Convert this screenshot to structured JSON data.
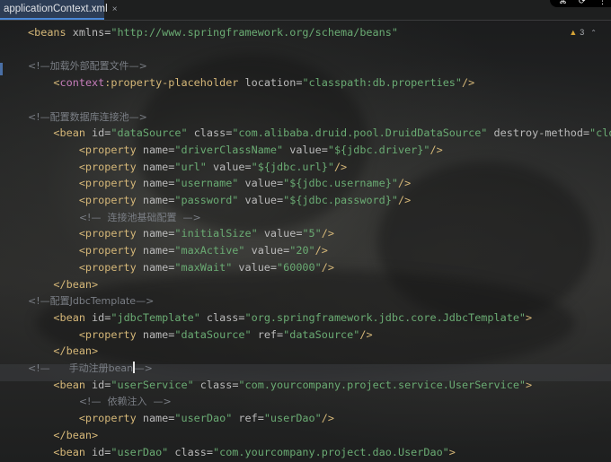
{
  "tab": {
    "filename": "applicationContext.xml",
    "close": "×"
  },
  "window_controls": {
    "icons": [
      "⌘",
      "⟳",
      "⋮"
    ]
  },
  "inspection": {
    "warnings": "3"
  },
  "lines": [
    [
      [
        "t",
        "<"
      ],
      [
        "t",
        "beans"
      ],
      [
        "a",
        " xmlns="
      ],
      [
        "v",
        "\"http://www.springframework.org/schema/beans\""
      ]
    ],
    [],
    [
      [
        "c",
        "<!—加载外部配置文件—>"
      ]
    ],
    [
      [
        "p",
        "    "
      ],
      [
        "t",
        "<"
      ],
      [
        "ns",
        "context"
      ],
      [
        "t",
        ":property-placeholder"
      ],
      [
        "a",
        " location="
      ],
      [
        "v",
        "\"classpath:db.properties\""
      ],
      [
        "t",
        "/>"
      ]
    ],
    [],
    [
      [
        "c",
        "<!—配置数据库连接池—>"
      ]
    ],
    [
      [
        "p",
        "    "
      ],
      [
        "t",
        "<bean"
      ],
      [
        "a",
        " id="
      ],
      [
        "v",
        "\"dataSource\""
      ],
      [
        "a",
        " class="
      ],
      [
        "v",
        "\"com.alibaba.druid.pool.DruidDataSource\""
      ],
      [
        "a",
        " destroy-method="
      ],
      [
        "v",
        "\"close\""
      ],
      [
        "t",
        ">"
      ]
    ],
    [
      [
        "p",
        "        "
      ],
      [
        "t",
        "<property"
      ],
      [
        "a",
        " name="
      ],
      [
        "v",
        "\"driverClassName\""
      ],
      [
        "a",
        " value="
      ],
      [
        "v",
        "\"${jdbc.driver}\""
      ],
      [
        "t",
        "/>"
      ]
    ],
    [
      [
        "p",
        "        "
      ],
      [
        "t",
        "<property"
      ],
      [
        "a",
        " name="
      ],
      [
        "v",
        "\"url\""
      ],
      [
        "a",
        " value="
      ],
      [
        "v",
        "\"${jdbc.url}\""
      ],
      [
        "t",
        "/>"
      ]
    ],
    [
      [
        "p",
        "        "
      ],
      [
        "t",
        "<property"
      ],
      [
        "a",
        " name="
      ],
      [
        "v",
        "\"username\""
      ],
      [
        "a",
        " value="
      ],
      [
        "v",
        "\"${jdbc.username}\""
      ],
      [
        "t",
        "/>"
      ]
    ],
    [
      [
        "p",
        "        "
      ],
      [
        "t",
        "<property"
      ],
      [
        "a",
        " name="
      ],
      [
        "v",
        "\"password\""
      ],
      [
        "a",
        " value="
      ],
      [
        "v",
        "\"${jdbc.password}\""
      ],
      [
        "t",
        "/>"
      ]
    ],
    [
      [
        "p",
        "        "
      ],
      [
        "c",
        "<!—  连接池基础配置  —>"
      ]
    ],
    [
      [
        "p",
        "        "
      ],
      [
        "t",
        "<property"
      ],
      [
        "a",
        " name="
      ],
      [
        "v",
        "\"initialSize\""
      ],
      [
        "a",
        " value="
      ],
      [
        "v",
        "\"5\""
      ],
      [
        "t",
        "/>"
      ]
    ],
    [
      [
        "p",
        "        "
      ],
      [
        "t",
        "<property"
      ],
      [
        "a",
        " name="
      ],
      [
        "v",
        "\"maxActive\""
      ],
      [
        "a",
        " value="
      ],
      [
        "v",
        "\"20\""
      ],
      [
        "t",
        "/>"
      ]
    ],
    [
      [
        "p",
        "        "
      ],
      [
        "t",
        "<property"
      ],
      [
        "a",
        " name="
      ],
      [
        "v",
        "\"maxWait\""
      ],
      [
        "a",
        " value="
      ],
      [
        "v",
        "\"60000\""
      ],
      [
        "t",
        "/>"
      ]
    ],
    [
      [
        "p",
        "    "
      ],
      [
        "t",
        "</bean>"
      ]
    ],
    [
      [
        "c",
        "<!—配置JdbcTemplate—>"
      ]
    ],
    [
      [
        "p",
        "    "
      ],
      [
        "t",
        "<bean"
      ],
      [
        "a",
        " id="
      ],
      [
        "v",
        "\"jdbcTemplate\""
      ],
      [
        "a",
        " class="
      ],
      [
        "v",
        "\"org.springframework.jdbc.core.JdbcTemplate\""
      ],
      [
        "t",
        ">"
      ]
    ],
    [
      [
        "p",
        "        "
      ],
      [
        "t",
        "<property"
      ],
      [
        "a",
        " name="
      ],
      [
        "v",
        "\"dataSource\""
      ],
      [
        "a",
        " ref="
      ],
      [
        "v",
        "\"dataSource\""
      ],
      [
        "t",
        "/>"
      ]
    ],
    [
      [
        "p",
        "    "
      ],
      [
        "t",
        "</bean>"
      ]
    ],
    [
      [
        "c",
        "<!—      手动注册bean"
      ],
      [
        "cursor",
        ""
      ],
      [
        "c",
        "—>"
      ]
    ],
    [
      [
        "p",
        "    "
      ],
      [
        "t",
        "<bean"
      ],
      [
        "a",
        " id="
      ],
      [
        "v",
        "\"userService\""
      ],
      [
        "a",
        " class="
      ],
      [
        "v",
        "\"com.yourcompany.project.service.UserService\""
      ],
      [
        "t",
        ">"
      ]
    ],
    [
      [
        "p",
        "        "
      ],
      [
        "c",
        "<!—  依赖注入  —>"
      ]
    ],
    [
      [
        "p",
        "        "
      ],
      [
        "t",
        "<property"
      ],
      [
        "a",
        " name="
      ],
      [
        "v",
        "\"userDao\""
      ],
      [
        "a",
        " ref="
      ],
      [
        "v",
        "\"userDao\""
      ],
      [
        "t",
        "/>"
      ]
    ],
    [
      [
        "p",
        "    "
      ],
      [
        "t",
        "</bean>"
      ]
    ],
    [
      [
        "p",
        "    "
      ],
      [
        "t",
        "<bean"
      ],
      [
        "a",
        " id="
      ],
      [
        "v",
        "\"userDao\""
      ],
      [
        "a",
        " class="
      ],
      [
        "v",
        "\"com.yourcompany.project.dao.UserDao\""
      ],
      [
        "t",
        ">"
      ]
    ]
  ]
}
